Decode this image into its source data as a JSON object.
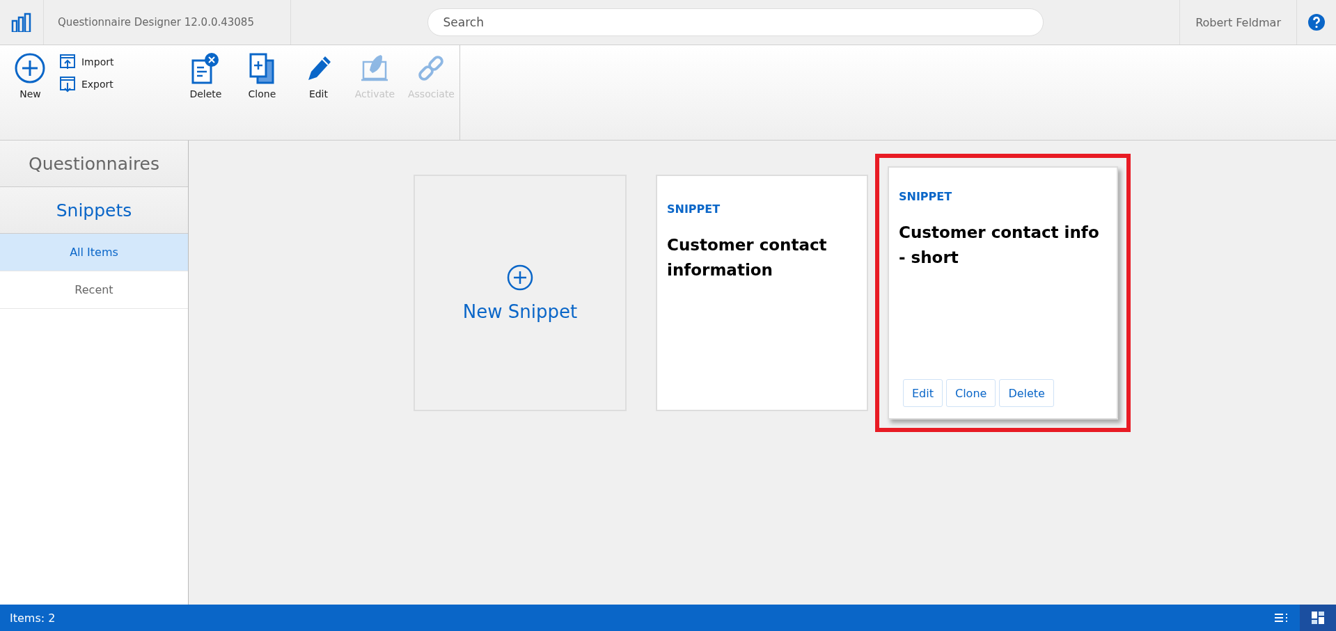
{
  "header": {
    "app_title": "Questionnaire Designer 12.0.0.43085",
    "search": {
      "placeholder": "Search"
    },
    "user": "Robert Feldmar"
  },
  "toolbar": {
    "items": [
      {
        "kind": "big",
        "label": "New",
        "disabled": false
      },
      {
        "kind": "stack",
        "children": [
          {
            "label": "Import",
            "disabled": false
          },
          {
            "label": "Export",
            "disabled": false
          }
        ]
      },
      {
        "kind": "big",
        "label": "Delete",
        "disabled": false
      },
      {
        "kind": "big",
        "label": "Clone",
        "disabled": false
      },
      {
        "kind": "big",
        "label": "Edit",
        "disabled": false
      },
      {
        "kind": "big",
        "label": "Activate",
        "disabled": true
      },
      {
        "kind": "big",
        "label": "Associate",
        "disabled": true
      }
    ]
  },
  "sidebar": {
    "sections": [
      {
        "label": "Questionnaires",
        "selected": false
      },
      {
        "label": "Snippets",
        "selected": true
      }
    ],
    "items": [
      {
        "label": "All Items",
        "selected": true
      },
      {
        "label": "Recent",
        "selected": false
      }
    ]
  },
  "cards": [
    {
      "kind": "new",
      "label": "New Snippet"
    },
    {
      "kind": "snippet",
      "type_label": "SNIPPET",
      "title": "Customer contact information",
      "highlighted": false
    },
    {
      "kind": "snippet",
      "type_label": "SNIPPET",
      "title": "Customer contact info - short",
      "highlighted": true,
      "actions": [
        "Edit",
        "Clone",
        "Delete"
      ]
    }
  ],
  "status_bar": {
    "text": "Items: 2",
    "views": [
      {
        "kind": "list",
        "selected": false
      },
      {
        "kind": "tiles",
        "selected": true
      }
    ]
  }
}
